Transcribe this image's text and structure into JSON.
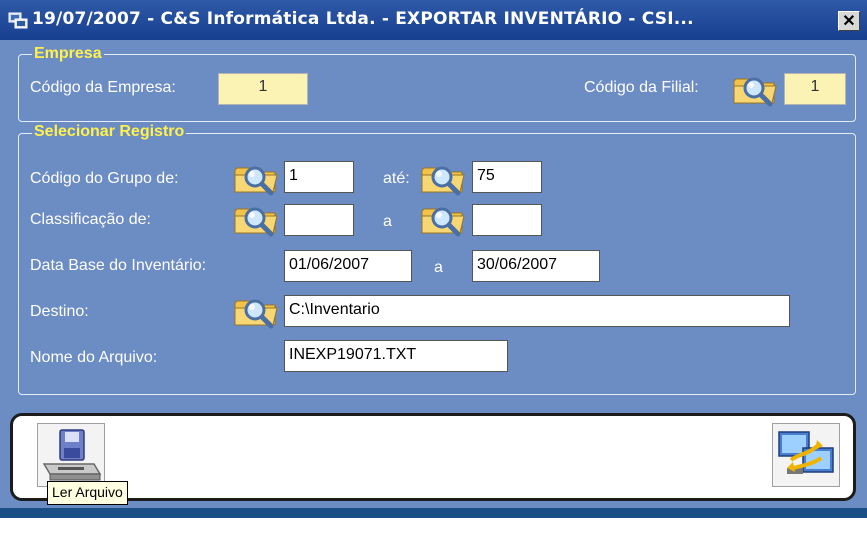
{
  "window": {
    "title": "19/07/2007  -  C&S Informática Ltda.  -  EXPORTAR INVENTÁRIO  -  CSI...",
    "close_glyph": "✕"
  },
  "empresa": {
    "legend": "Empresa",
    "codigo_empresa_label": "Código da Empresa:",
    "codigo_empresa_value": "1",
    "codigo_filial_label": "Código da Filial:",
    "codigo_filial_value": "1"
  },
  "registro": {
    "legend": "Selecionar Registro",
    "grupo_label": "Código do Grupo de:",
    "grupo_de": "1",
    "ate_label": "até:",
    "grupo_ate": "75",
    "classificacao_label": "Classificação de:",
    "classificacao_de": "",
    "a_label": "a",
    "classificacao_a": "",
    "data_label": "Data Base do Inventário:",
    "data_de": "01/06/2007",
    "data_a_label": "a",
    "data_ate": "30/06/2007",
    "destino_label": "Destino:",
    "destino_value": "C:\\Inventario",
    "arquivo_label": "Nome do Arquivo:",
    "arquivo_value": "INEXP19071.TXT"
  },
  "tooltip": {
    "text": "Ler Arquivo"
  },
  "icons": {
    "lookup": "folder-search-icon",
    "read_file": "floppy-drive-icon",
    "export": "computer-transfer-icon"
  },
  "colors": {
    "window_bg": "#6c8cc4",
    "titlebar": "#163f8f",
    "legend_text": "#fff14d",
    "readonly_field": "#fbf3b3"
  }
}
